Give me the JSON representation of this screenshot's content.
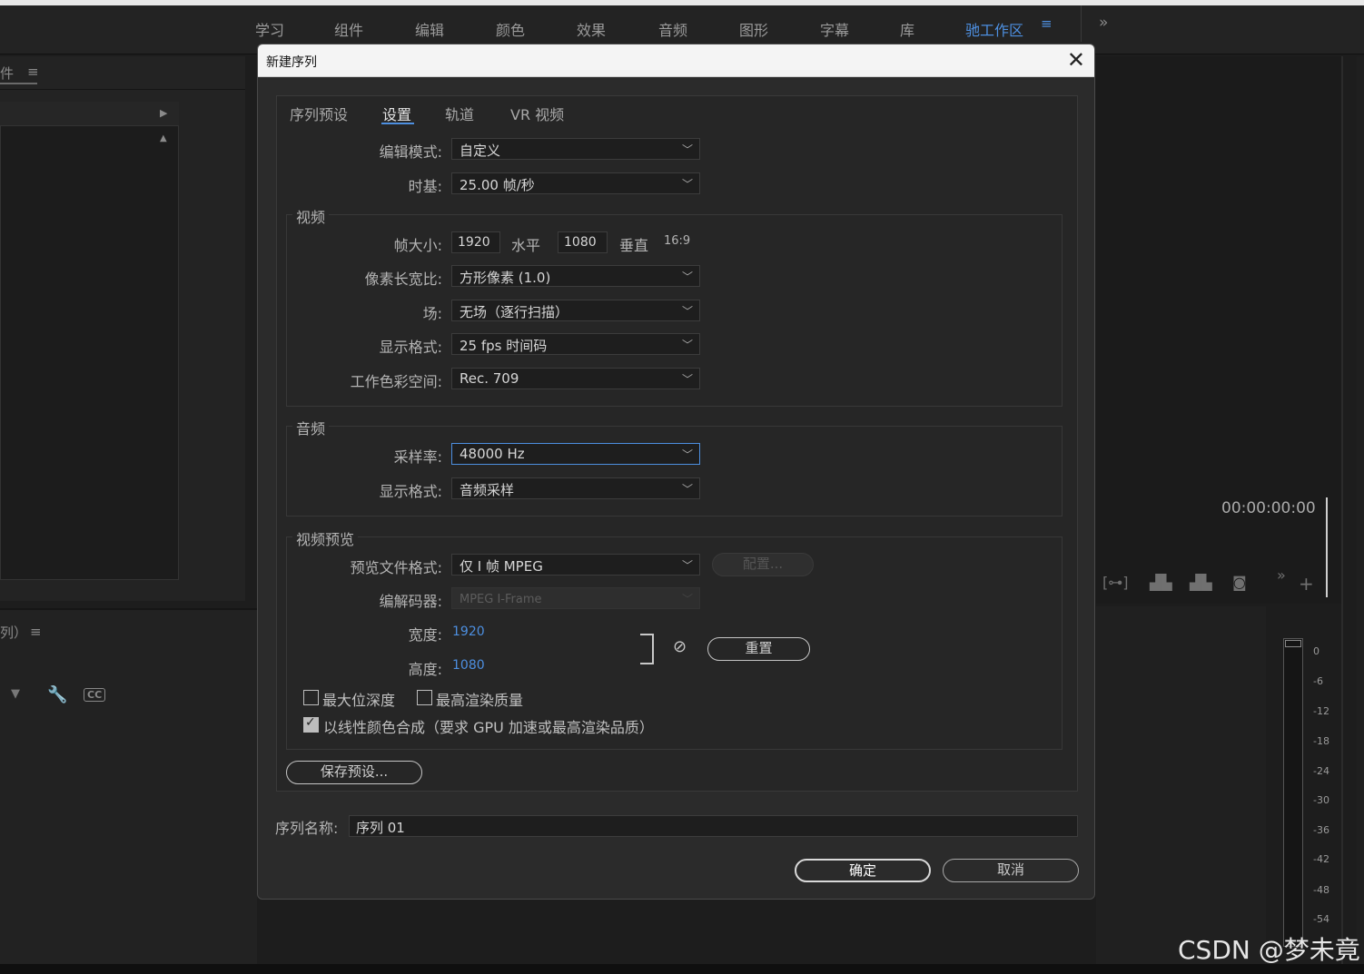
{
  "workspace_tabs": [
    "学习",
    "组件",
    "编辑",
    "颜色",
    "效果",
    "音频",
    "图形",
    "字幕",
    "库",
    "驰工作区"
  ],
  "workspace_active": "驰工作区",
  "workspace_menu_icon": "≡",
  "workspace_more_icon": "»",
  "left_panel": {
    "title_fragment": "件",
    "menu_icon": "≡"
  },
  "timeline_panel": {
    "title_fragment": "列）",
    "menu_icon": "≡",
    "cc_label": "CC"
  },
  "program_monitor": {
    "timecode": "00:00:00:00"
  },
  "audio_meter_ticks": [
    "0",
    "-6",
    "-12",
    "-18",
    "-24",
    "-30",
    "-36",
    "-42",
    "-48",
    "-54"
  ],
  "watermark": "CSDN @梦未竟",
  "dialog": {
    "title": "新建序列",
    "close_icon": "✕",
    "tabs": [
      "序列预设",
      "设置",
      "轨道",
      "VR 视频"
    ],
    "active_tab": "设置",
    "edit_mode_label": "编辑模式:",
    "edit_mode_value": "自定义",
    "timebase_label": "时基:",
    "timebase_value": "25.00  帧/秒",
    "video_group": {
      "title": "视频",
      "frame_size_label": "帧大小:",
      "frame_width": "1920",
      "horizontal_label": "水平",
      "frame_height": "1080",
      "vertical_label": "垂直",
      "aspect_ratio": "16:9",
      "pixel_aspect_label": "像素长宽比:",
      "pixel_aspect_value": "方形像素 (1.0)",
      "fields_label": "场:",
      "fields_value": "无场（逐行扫描）",
      "display_format_label": "显示格式:",
      "display_format_value": "25 fps 时间码",
      "color_space_label": "工作色彩空间:",
      "color_space_value": "Rec. 709"
    },
    "audio_group": {
      "title": "音频",
      "sample_rate_label": "采样率:",
      "sample_rate_value": "48000 Hz",
      "display_format_label": "显示格式:",
      "display_format_value": "音频采样"
    },
    "preview_group": {
      "title": "视频预览",
      "file_format_label": "预览文件格式:",
      "file_format_value": "仅 I 帧 MPEG",
      "configure_button": "配置...",
      "codec_label": "编解码器:",
      "codec_value": "MPEG I-Frame",
      "width_label": "宽度:",
      "width_value": "1920",
      "height_label": "高度:",
      "height_value": "1080",
      "link_icon": "link-icon",
      "reset_button": "重置",
      "max_bit_depth_label": "最大位深度",
      "max_bit_depth_checked": false,
      "max_render_quality_label": "最高渲染质量",
      "max_render_quality_checked": false,
      "linear_color_label": "以线性颜色合成（要求 GPU 加速或最高渲染品质）",
      "linear_color_checked": true
    },
    "save_preset_button": "保存预设...",
    "sequence_name_label": "序列名称:",
    "sequence_name_value": "序列 01",
    "ok_button": "确定",
    "cancel_button": "取消"
  },
  "colors": {
    "accent": "#4d8fe0",
    "dialog_bg": "#2b2b2b",
    "app_bg": "#1d1d1d"
  }
}
